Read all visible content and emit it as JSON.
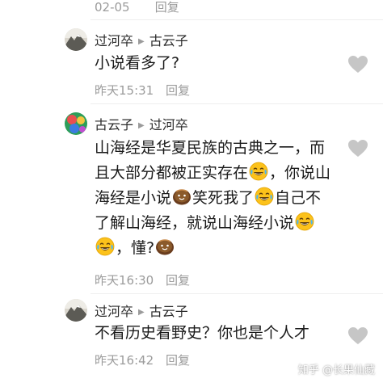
{
  "top_meta": {
    "time": "02-05",
    "reply": "回复"
  },
  "comments": [
    {
      "author": "过河卒",
      "reply_to": "古云子",
      "lines": [
        "小说看多了?"
      ],
      "time": "昨天15:31",
      "reply": "回复",
      "avatar_icon": "mountain-avatar-icon"
    },
    {
      "author": "古云子",
      "reply_to": "过河卒",
      "lines": [
        [
          "山海经是华夏民族的古典之一，而"
        ],
        [
          "且大部分都被正实存在",
          "emoji:laugh-cry",
          "，你说山"
        ],
        [
          "海经是小说",
          "emoji:bread",
          "笑死我了",
          "emoji:laugh-cry",
          "自己不"
        ],
        [
          "了解山海经，就说山海经小说",
          "emoji:laugh-cry"
        ],
        [
          "emoji:laugh-cry",
          "，懂?",
          "emoji:bread"
        ]
      ],
      "time": "昨天16:30",
      "reply": "回复",
      "avatar_icon": "colorful-avatar-icon"
    },
    {
      "author": "过河卒",
      "reply_to": "古云子",
      "lines": [
        "不看历史看野史？你也是个人才"
      ],
      "time": "昨天16:42",
      "reply": "回复",
      "avatar_icon": "mountain-avatar-icon"
    }
  ],
  "watermark": "知乎 @长果仙藏",
  "colors": {
    "meta_gray": "#9b9b9b",
    "like_gray": "#c6c6c6",
    "text": "#1a1a1a"
  }
}
